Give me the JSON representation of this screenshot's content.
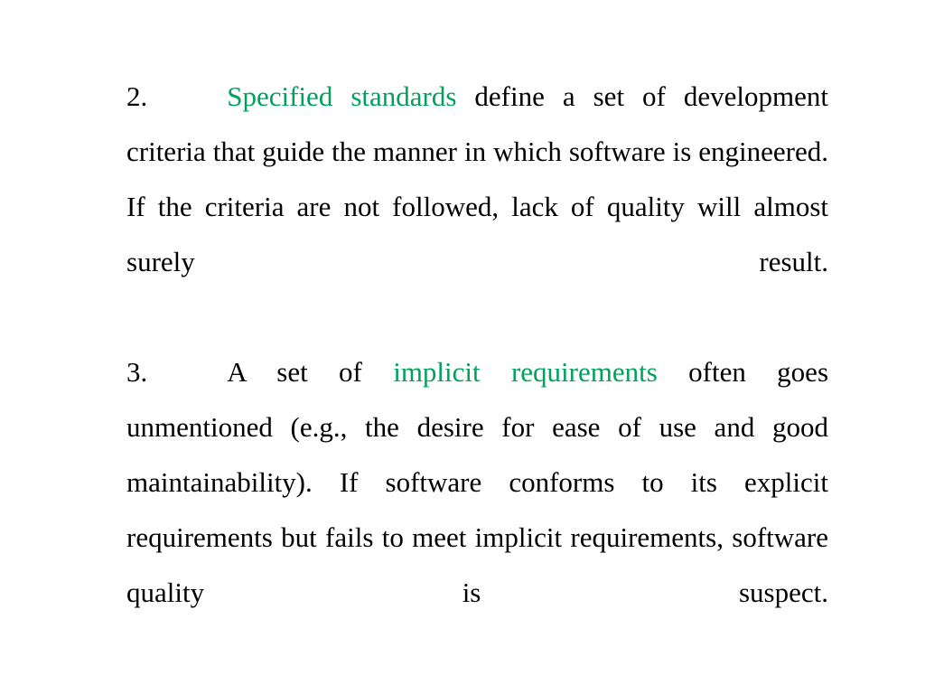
{
  "slide": {
    "background_color": "#ffffff",
    "text_color": "#000000",
    "highlight_color": "#00a15c",
    "font_size_px": 31,
    "line_height_px": 61,
    "text_align": "justify"
  },
  "content": {
    "items": [
      {
        "number": "2.",
        "highlight": "Specified standards",
        "rest": " define a set of development criteria that guide the manner in which software is engineered. If the criteria are not followed, lack of quality will almost surely result.",
        "full_text": "2.\tSpecified standards define a set of development criteria that guide the manner in which software is engineered. If the criteria are not followed, lack of quality will almost surely result."
      },
      {
        "number": "3.",
        "lead": "A set of ",
        "highlight": "implicit requirements",
        "rest": " often goes unmentioned (e.g., the desire for ease of use and good maintainability). If software conforms to its explicit requirements but fails to meet implicit requirements, software quality is suspect.",
        "full_text": "3.\tA set of implicit requirements often goes unmentioned (e.g., the desire for ease of use and good maintainability). If software conforms to its explicit requirements but fails to meet implicit requirements, software quality is suspect."
      }
    ]
  }
}
